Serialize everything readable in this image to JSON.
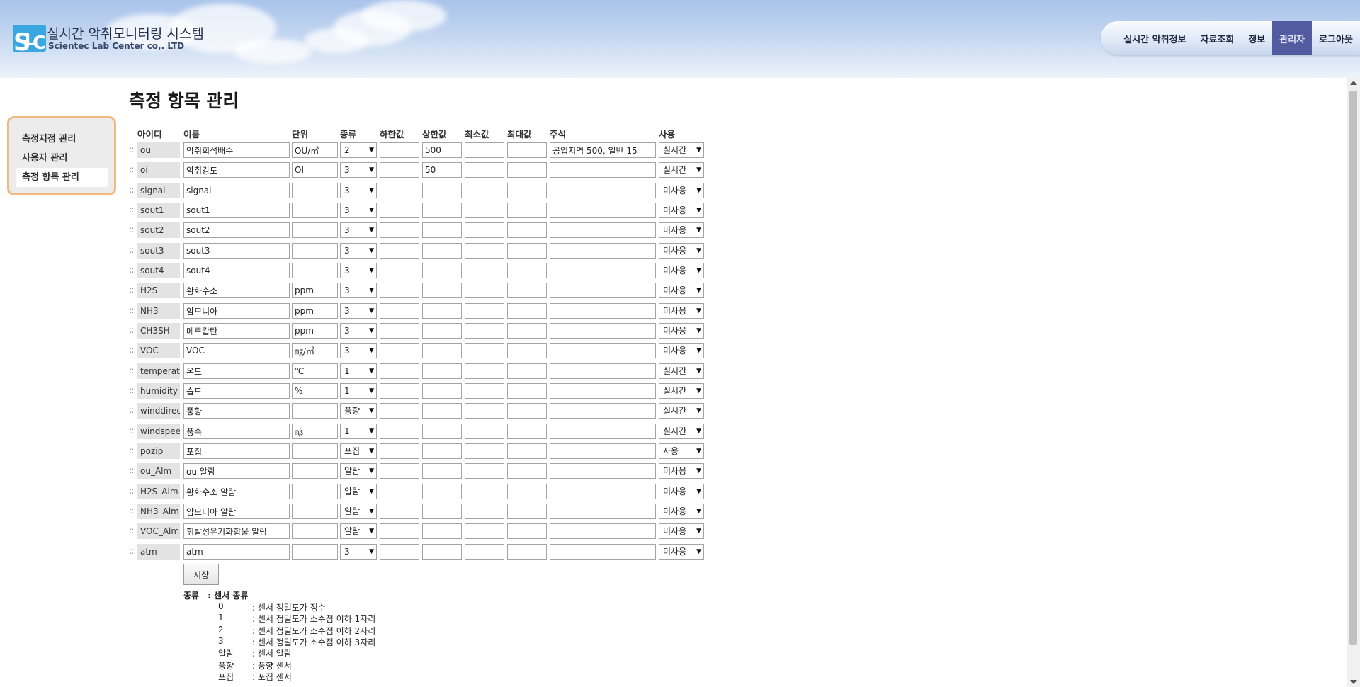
{
  "brand": {
    "title": "실시간 악취모니터링 시스템",
    "subtitle": "Scientec Lab Center co,. LTD",
    "logo_text": "SLC"
  },
  "topnav": [
    {
      "label": "실시간 악취정보",
      "active": false
    },
    {
      "label": "자료조회",
      "active": false
    },
    {
      "label": "정보",
      "active": false
    },
    {
      "label": "관리자",
      "active": true
    },
    {
      "label": "로그아웃",
      "active": false
    }
  ],
  "sidebar": [
    {
      "label": "측정지점 관리",
      "active": false
    },
    {
      "label": "사용자 관리",
      "active": false
    },
    {
      "label": "측정 항목 관리",
      "active": true
    }
  ],
  "page": {
    "title": "측정 항목 관리"
  },
  "columns": [
    "아이디",
    "이름",
    "단위",
    "종류",
    "하한값",
    "상한값",
    "최소값",
    "최대값",
    "주석",
    "사용"
  ],
  "rows": [
    {
      "id": "ou",
      "name": "악취희석배수",
      "unit": "OU/㎥",
      "type": "2",
      "low": "",
      "high": "500",
      "min": "",
      "max": "",
      "note": "공업지역 500, 일반 15",
      "use": "실시간"
    },
    {
      "id": "oi",
      "name": "악취강도",
      "unit": "OI",
      "type": "3",
      "low": "",
      "high": "50",
      "min": "",
      "max": "",
      "note": "",
      "use": "실시간"
    },
    {
      "id": "signal",
      "name": "signal",
      "unit": "",
      "type": "3",
      "low": "",
      "high": "",
      "min": "",
      "max": "",
      "note": "",
      "use": "미사용"
    },
    {
      "id": "sout1",
      "name": "sout1",
      "unit": "",
      "type": "3",
      "low": "",
      "high": "",
      "min": "",
      "max": "",
      "note": "",
      "use": "미사용"
    },
    {
      "id": "sout2",
      "name": "sout2",
      "unit": "",
      "type": "3",
      "low": "",
      "high": "",
      "min": "",
      "max": "",
      "note": "",
      "use": "미사용"
    },
    {
      "id": "sout3",
      "name": "sout3",
      "unit": "",
      "type": "3",
      "low": "",
      "high": "",
      "min": "",
      "max": "",
      "note": "",
      "use": "미사용"
    },
    {
      "id": "sout4",
      "name": "sout4",
      "unit": "",
      "type": "3",
      "low": "",
      "high": "",
      "min": "",
      "max": "",
      "note": "",
      "use": "미사용"
    },
    {
      "id": "H2S",
      "name": "황화수소",
      "unit": "ppm",
      "type": "3",
      "low": "",
      "high": "",
      "min": "",
      "max": "",
      "note": "",
      "use": "미사용"
    },
    {
      "id": "NH3",
      "name": "암모니아",
      "unit": "ppm",
      "type": "3",
      "low": "",
      "high": "",
      "min": "",
      "max": "",
      "note": "",
      "use": "미사용"
    },
    {
      "id": "CH3SH",
      "name": "메르캅탄",
      "unit": "ppm",
      "type": "3",
      "low": "",
      "high": "",
      "min": "",
      "max": "",
      "note": "",
      "use": "미사용"
    },
    {
      "id": "VOC",
      "name": "VOC",
      "unit": "㎎/㎥",
      "type": "3",
      "low": "",
      "high": "",
      "min": "",
      "max": "",
      "note": "",
      "use": "미사용"
    },
    {
      "id": "temperatu",
      "name": "온도",
      "unit": "℃",
      "type": "1",
      "low": "",
      "high": "",
      "min": "",
      "max": "",
      "note": "",
      "use": "실시간"
    },
    {
      "id": "humidity",
      "name": "습도",
      "unit": "%",
      "type": "1",
      "low": "",
      "high": "",
      "min": "",
      "max": "",
      "note": "",
      "use": "실시간"
    },
    {
      "id": "winddirect",
      "name": "풍향",
      "unit": "",
      "type": "풍향",
      "low": "",
      "high": "",
      "min": "",
      "max": "",
      "note": "",
      "use": "실시간"
    },
    {
      "id": "windspeec",
      "name": "풍속",
      "unit": "㎧",
      "type": "1",
      "low": "",
      "high": "",
      "min": "",
      "max": "",
      "note": "",
      "use": "실시간"
    },
    {
      "id": "pozip",
      "name": "포집",
      "unit": "",
      "type": "포집",
      "low": "",
      "high": "",
      "min": "",
      "max": "",
      "note": "",
      "use": "사용"
    },
    {
      "id": "ou_Alm",
      "name": "ou 알람",
      "unit": "",
      "type": "알람",
      "low": "",
      "high": "",
      "min": "",
      "max": "",
      "note": "",
      "use": "미사용"
    },
    {
      "id": "H2S_Alm",
      "name": "황화수소 알람",
      "unit": "",
      "type": "알람",
      "low": "",
      "high": "",
      "min": "",
      "max": "",
      "note": "",
      "use": "미사용"
    },
    {
      "id": "NH3_Alm",
      "name": "암모니아 알람",
      "unit": "",
      "type": "알람",
      "low": "",
      "high": "",
      "min": "",
      "max": "",
      "note": "",
      "use": "미사용"
    },
    {
      "id": "VOC_Alm",
      "name": "휘발성유기화합물 알람",
      "unit": "",
      "type": "알람",
      "low": "",
      "high": "",
      "min": "",
      "max": "",
      "note": "",
      "use": "미사용"
    },
    {
      "id": "atm",
      "name": "atm",
      "unit": "",
      "type": "3",
      "low": "",
      "high": "",
      "min": "",
      "max": "",
      "note": "",
      "use": "미사용"
    }
  ],
  "save_label": "저장",
  "legend": {
    "title": "종류　: 센서 종류",
    "items": [
      {
        "key": "0",
        "desc": ": 센서 정밀도가 정수"
      },
      {
        "key": "1",
        "desc": ": 센서 정밀도가 소수점 이하 1자리"
      },
      {
        "key": "2",
        "desc": ": 센서 정밀도가 소수점 이하 2자리"
      },
      {
        "key": "3",
        "desc": ": 센서 정밀도가 소수점 이하 3자리"
      },
      {
        "key": "알람",
        "desc": ": 센서 알람"
      },
      {
        "key": "풍향",
        "desc": ": 풍향 센서"
      },
      {
        "key": "포집",
        "desc": ": 포집 센서"
      }
    ]
  },
  "colors": {
    "active_nav": "#525aa0",
    "sidebar_border": "#f3ba80",
    "id_cell": "#e3e3e3"
  }
}
